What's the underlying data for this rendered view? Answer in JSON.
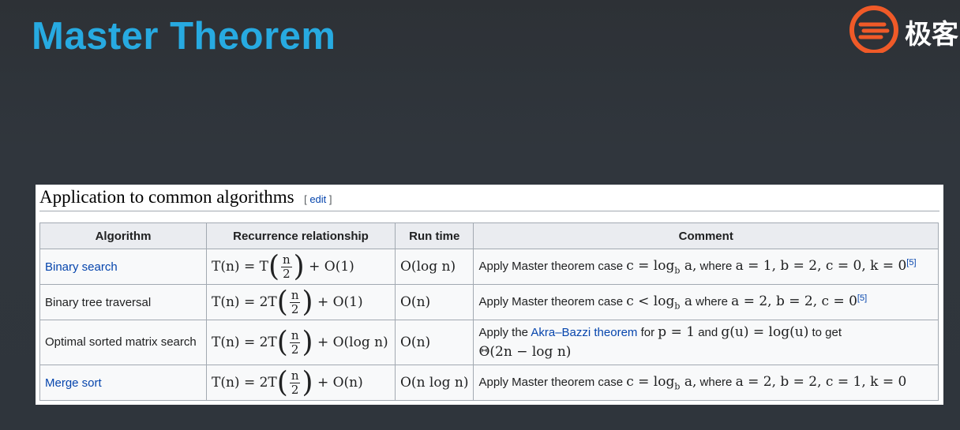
{
  "slide": {
    "title": "Master Theorem",
    "logo_text": "极客",
    "logo_icon": "geek-time-logo-icon",
    "title_color": "#27aae1"
  },
  "section": {
    "title": "Application to common algorithms",
    "edit_bracket_open": "[",
    "edit_label": "edit",
    "edit_bracket_close": "]"
  },
  "table": {
    "headers": [
      "Algorithm",
      "Recurrence relationship",
      "Run time",
      "Comment"
    ],
    "rows": [
      {
        "algorithm": "Binary search",
        "algorithm_is_link": true,
        "recurrence": {
          "lhs": "T(n) = T",
          "frac_num": "n",
          "frac_den": "2",
          "rest": "+ O(1)"
        },
        "runtime": "O(log n)",
        "comment": {
          "prefix": "Apply Master theorem case",
          "math1": "c = log",
          "math1_sub": "b",
          "math1_tail": "a,",
          "middle": "where",
          "math2": "a = 1, b = 2, c = 0, k = 0",
          "ref": "[5]"
        }
      },
      {
        "algorithm": "Binary tree traversal",
        "algorithm_is_link": false,
        "recurrence": {
          "lhs": "T(n) = 2T",
          "frac_num": "n",
          "frac_den": "2",
          "rest": "+ O(1)"
        },
        "runtime": "O(n)",
        "comment": {
          "prefix": "Apply Master theorem case",
          "math1": "c < log",
          "math1_sub": "b",
          "math1_tail": "a",
          "middle": "where",
          "math2": "a = 2, b = 2, c = 0",
          "ref": "[5]"
        }
      },
      {
        "algorithm": "Optimal sorted matrix search",
        "algorithm_is_link": false,
        "recurrence": {
          "lhs": "T(n) = 2T",
          "frac_num": "n",
          "frac_den": "2",
          "rest": "+ O(log n)"
        },
        "runtime": "O(n)",
        "comment": {
          "prefix": "Apply the",
          "link": "Akra–Bazzi theorem",
          "mid1": "for",
          "math1": "p = 1",
          "mid2": "and",
          "math2": "g(u) = log(u)",
          "mid3": "to get",
          "line2": "Θ(2n − log n)"
        }
      },
      {
        "algorithm": "Merge sort",
        "algorithm_is_link": true,
        "recurrence": {
          "lhs": "T(n) = 2T",
          "frac_num": "n",
          "frac_den": "2",
          "rest": "+ O(n)"
        },
        "runtime": "O(n log n)",
        "comment": {
          "prefix": "Apply Master theorem case",
          "math1": "c = log",
          "math1_sub": "b",
          "math1_tail": "a,",
          "middle": "where",
          "math2": "a = 2, b = 2, c = 1, k = 0"
        }
      }
    ]
  }
}
